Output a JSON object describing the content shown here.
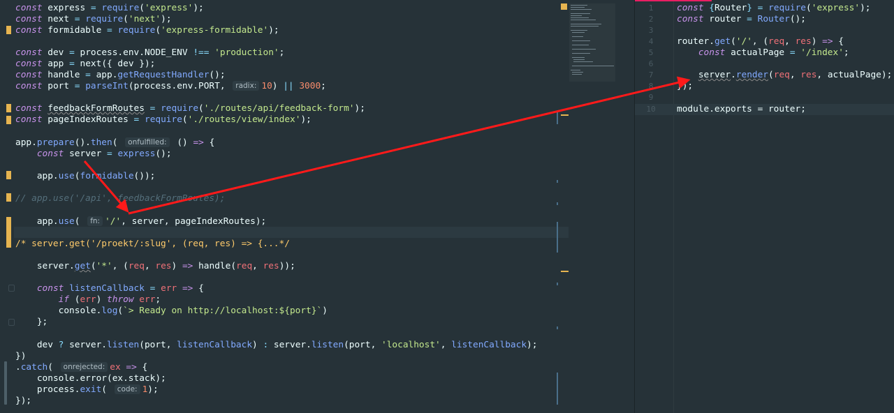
{
  "colors": {
    "background": "#263238",
    "keyword": "#c792ea",
    "function": "#82aaff",
    "string": "#c3e88d",
    "number": "#f78c6c",
    "arrow_annotation": "#ff1a1a",
    "change_marker": "#e6b450"
  },
  "left_editor": {
    "code": {
      "l1_name": "express",
      "l1_str": "'express'",
      "l2_name": "next",
      "l2_str": "'next'",
      "l3_name": "formidable",
      "l3_str": "'express-formidable'",
      "l5_env": "process.env.NODE_ENV",
      "l5_str": "'production'",
      "l6_call": "next({ dev })",
      "l7_fn": "getRequestHandler",
      "l8_env": "process.env.PORT,",
      "l8_hint": "radix:",
      "l8_num1": "10",
      "l8_num2": "3000",
      "l10_name": "feedbackFormRoutes",
      "l10_str": "'./routes/api/feedback-form'",
      "l11_name": "pageIndexRoutes",
      "l11_str": "'./routes/view/index'",
      "l13_fn1": "prepare",
      "l13_fn2": "then",
      "l13_hint": "onfulfilled:",
      "l14_name": "server",
      "l14_call": "express",
      "l16_call": "formidable",
      "l18_comment": "// app.use('/api', feedbackFormRoutes);",
      "l20_hint": "fn:",
      "l20_str": "'/'",
      "l20_rest": ", server, pageIndexRoutes);",
      "l22_comment": "/* server.get('/proekt/:slug', (req, res) => {...*/",
      "l24_str": "'*'",
      "l24_call": "handle",
      "l26_name": "listenCallback",
      "l26_param": "err",
      "l27_kw1": "if",
      "l27_kw2": "throw",
      "l28_tpl": "`> Ready on http://localhost:${port}`",
      "l30_fn": "listen",
      "l30_str": "'localhost'",
      "l32_fn": "catch",
      "l32_hint": "onrejected:",
      "l32_param": "ex",
      "l33_text": "console.error(ex.stack);",
      "l34_hint": "code:",
      "l34_num": "1"
    }
  },
  "right_editor": {
    "line_numbers": [
      "1",
      "2",
      "3",
      "4",
      "5",
      "6",
      "7",
      "8",
      "9",
      "10"
    ],
    "code": {
      "r1_str": "'express'",
      "r4_str": "'/'",
      "r5_name": "actualPage",
      "r5_str": "'/index'",
      "r7_obj": "server",
      "r7_fn": "render",
      "r10_text": "module.exports = router;"
    }
  }
}
